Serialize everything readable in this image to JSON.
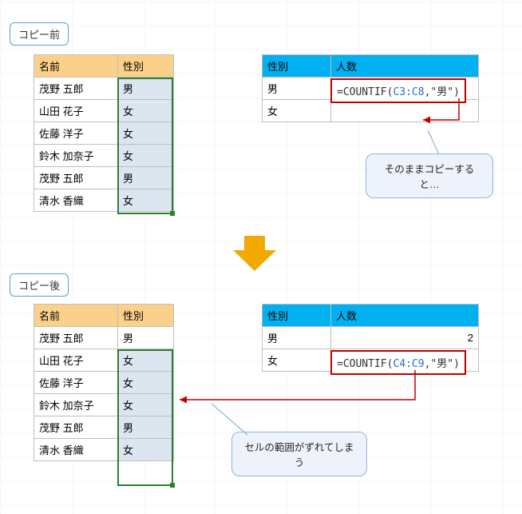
{
  "tags": {
    "before": "コピー前",
    "after": "コピー後"
  },
  "headers": {
    "name": "名前",
    "sex": "性別",
    "count": "人数"
  },
  "people": [
    {
      "name": "茂野 五郎",
      "sex": "男"
    },
    {
      "name": "山田 花子",
      "sex": "女"
    },
    {
      "name": "佐藤 洋子",
      "sex": "女"
    },
    {
      "name": "鈴木 加奈子",
      "sex": "女"
    },
    {
      "name": "茂野 五郎",
      "sex": "男"
    },
    {
      "name": "清水 香織",
      "sex": "女"
    }
  ],
  "countRows": {
    "male": "男",
    "female": "女"
  },
  "formulas": {
    "before": {
      "prefix": "=COUNTIF(",
      "range": "C3:C8",
      "suffix": ",\"男\")"
    },
    "after": {
      "prefix": "=COUNTIF(",
      "range": "C4:C9",
      "suffix": ",\"男\")"
    },
    "resultMale": "2"
  },
  "callouts": {
    "copy": "そのままコピーすると…",
    "shift": "セルの範囲がずれてしまう"
  },
  "chart_data": {
    "type": "table",
    "description": "Demonstration of relative reference shift when copying a COUNTIF formula",
    "source_table_columns": [
      "名前",
      "性別"
    ],
    "source_table_rows": [
      [
        "茂野 五郎",
        "男"
      ],
      [
        "山田 花子",
        "女"
      ],
      [
        "佐藤 洋子",
        "女"
      ],
      [
        "鈴木 加奈子",
        "女"
      ],
      [
        "茂野 五郎",
        "男"
      ],
      [
        "清水 香織",
        "女"
      ]
    ],
    "summary_before_columns": [
      "性別",
      "人数"
    ],
    "summary_before_rows": [
      [
        "男",
        "=COUNTIF(C3:C8,\"男\")"
      ],
      [
        "女",
        ""
      ]
    ],
    "summary_after_columns": [
      "性別",
      "人数"
    ],
    "summary_after_rows": [
      [
        "男",
        2
      ],
      [
        "女",
        "=COUNTIF(C4:C9,\"男\")"
      ]
    ]
  }
}
